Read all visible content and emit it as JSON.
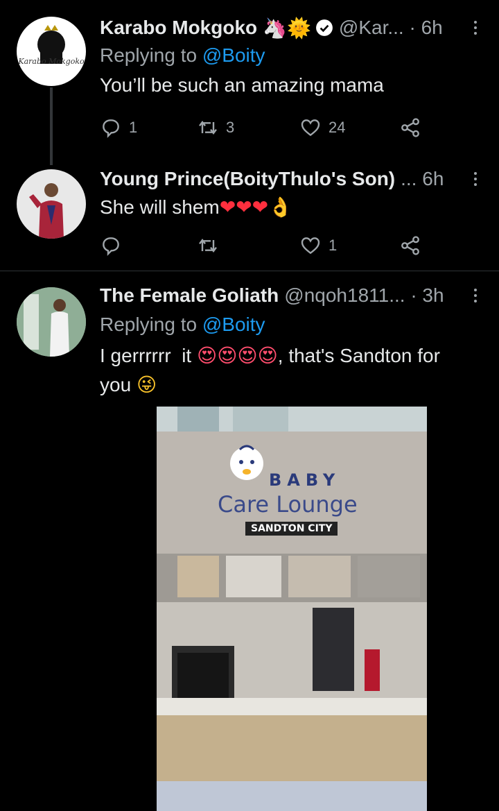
{
  "tweets": [
    {
      "name": "Karabo Mokgoko",
      "badges": [
        "🦄",
        "🌞"
      ],
      "verified": true,
      "handle": "@Kar... · 6h",
      "replying_prefix": "Replying to",
      "replying_mention": "@Boity",
      "text": "You’ll be such an amazing mama",
      "avatar_signature": "Karabo Mokgoko",
      "reply_count": "1",
      "retweet_count": "3",
      "like_count": "24"
    },
    {
      "name": "Young Prince(BoityThulo's Son)",
      "handle": "... 6h",
      "text": "She will shem",
      "text_emojis": "❤❤❤👌",
      "reply_count": "",
      "retweet_count": "",
      "like_count": "1"
    },
    {
      "name": "The Female Goliath",
      "handle": "@nqoh1811... · 3h",
      "replying_prefix": "Replying to",
      "replying_mention": "@Boity",
      "text_part1": "I gerrrrrr  it ",
      "text_emojis": "😍😍😍😍",
      "text_part2": ", that's Sandton for",
      "text_line2": "you ",
      "text_line2_emoji": "😜",
      "media": {
        "sign_baby": "BABY",
        "sign_line": "Care Lounge",
        "sign_place": "SANDTON CITY"
      }
    }
  ],
  "icons": [
    "reply-icon",
    "retweet-icon",
    "like-icon",
    "share-icon",
    "more-icon",
    "verified-icon"
  ],
  "colors": {
    "link": "#1d9bf0",
    "muted": "#a0a6ab",
    "verified": "#ffffff"
  }
}
